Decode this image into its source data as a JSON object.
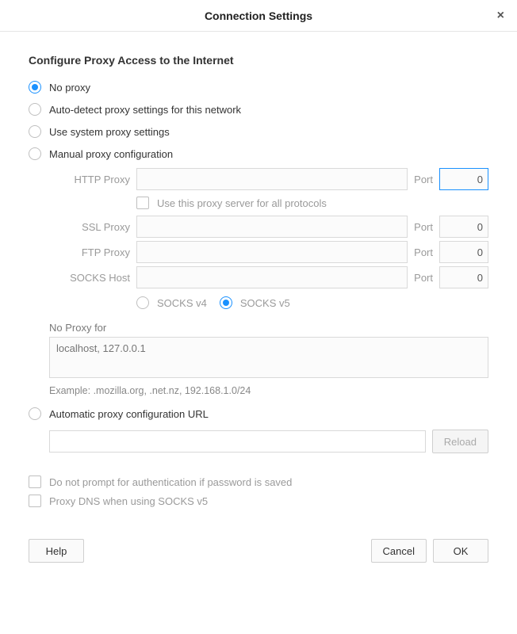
{
  "dialog": {
    "title": "Connection Settings",
    "close_glyph": "×"
  },
  "heading": "Configure Proxy Access to the Internet",
  "radios": {
    "no_proxy": "No proxy",
    "auto_detect": "Auto-detect proxy settings for this network",
    "system": "Use system proxy settings",
    "manual": "Manual proxy configuration",
    "auto_url": "Automatic proxy configuration URL"
  },
  "selected_radio": "no_proxy",
  "manual": {
    "http_label": "HTTP Proxy",
    "http_value": "",
    "http_port": "0",
    "share_checkbox": "Use this proxy server for all protocols",
    "ssl_label": "SSL Proxy",
    "ssl_value": "",
    "ssl_port": "0",
    "ftp_label": "FTP Proxy",
    "ftp_value": "",
    "ftp_port": "0",
    "socks_label": "SOCKS Host",
    "socks_value": "",
    "socks_port": "0",
    "port_label": "Port",
    "socks_v4": "SOCKS v4",
    "socks_v5": "SOCKS v5",
    "socks_selected": "v5",
    "no_proxy_for_label": "No Proxy for",
    "no_proxy_placeholder": "localhost, 127.0.0.1",
    "example": "Example: .mozilla.org, .net.nz, 192.168.1.0/24"
  },
  "auto_url": {
    "value": "",
    "reload_label": "Reload"
  },
  "bottom": {
    "no_prompt": "Do not prompt for authentication if password is saved",
    "proxy_dns": "Proxy DNS when using SOCKS v5"
  },
  "footer": {
    "help": "Help",
    "cancel": "Cancel",
    "ok": "OK"
  }
}
